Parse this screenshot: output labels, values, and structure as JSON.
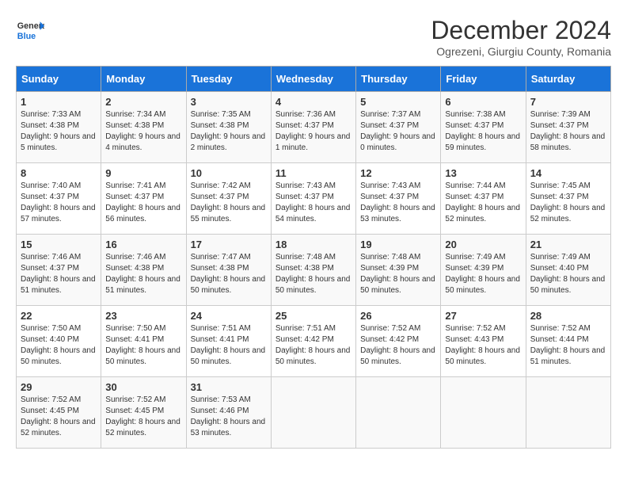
{
  "header": {
    "logo_line1": "General",
    "logo_line2": "Blue",
    "month_title": "December 2024",
    "subtitle": "Ogrezeni, Giurgiu County, Romania"
  },
  "columns": [
    "Sunday",
    "Monday",
    "Tuesday",
    "Wednesday",
    "Thursday",
    "Friday",
    "Saturday"
  ],
  "weeks": [
    [
      {
        "day": "1",
        "info": "Sunrise: 7:33 AM\nSunset: 4:38 PM\nDaylight: 9 hours and 5 minutes."
      },
      {
        "day": "2",
        "info": "Sunrise: 7:34 AM\nSunset: 4:38 PM\nDaylight: 9 hours and 4 minutes."
      },
      {
        "day": "3",
        "info": "Sunrise: 7:35 AM\nSunset: 4:38 PM\nDaylight: 9 hours and 2 minutes."
      },
      {
        "day": "4",
        "info": "Sunrise: 7:36 AM\nSunset: 4:37 PM\nDaylight: 9 hours and 1 minute."
      },
      {
        "day": "5",
        "info": "Sunrise: 7:37 AM\nSunset: 4:37 PM\nDaylight: 9 hours and 0 minutes."
      },
      {
        "day": "6",
        "info": "Sunrise: 7:38 AM\nSunset: 4:37 PM\nDaylight: 8 hours and 59 minutes."
      },
      {
        "day": "7",
        "info": "Sunrise: 7:39 AM\nSunset: 4:37 PM\nDaylight: 8 hours and 58 minutes."
      }
    ],
    [
      {
        "day": "8",
        "info": "Sunrise: 7:40 AM\nSunset: 4:37 PM\nDaylight: 8 hours and 57 minutes."
      },
      {
        "day": "9",
        "info": "Sunrise: 7:41 AM\nSunset: 4:37 PM\nDaylight: 8 hours and 56 minutes."
      },
      {
        "day": "10",
        "info": "Sunrise: 7:42 AM\nSunset: 4:37 PM\nDaylight: 8 hours and 55 minutes."
      },
      {
        "day": "11",
        "info": "Sunrise: 7:43 AM\nSunset: 4:37 PM\nDaylight: 8 hours and 54 minutes."
      },
      {
        "day": "12",
        "info": "Sunrise: 7:43 AM\nSunset: 4:37 PM\nDaylight: 8 hours and 53 minutes."
      },
      {
        "day": "13",
        "info": "Sunrise: 7:44 AM\nSunset: 4:37 PM\nDaylight: 8 hours and 52 minutes."
      },
      {
        "day": "14",
        "info": "Sunrise: 7:45 AM\nSunset: 4:37 PM\nDaylight: 8 hours and 52 minutes."
      }
    ],
    [
      {
        "day": "15",
        "info": "Sunrise: 7:46 AM\nSunset: 4:37 PM\nDaylight: 8 hours and 51 minutes."
      },
      {
        "day": "16",
        "info": "Sunrise: 7:46 AM\nSunset: 4:38 PM\nDaylight: 8 hours and 51 minutes."
      },
      {
        "day": "17",
        "info": "Sunrise: 7:47 AM\nSunset: 4:38 PM\nDaylight: 8 hours and 50 minutes."
      },
      {
        "day": "18",
        "info": "Sunrise: 7:48 AM\nSunset: 4:38 PM\nDaylight: 8 hours and 50 minutes."
      },
      {
        "day": "19",
        "info": "Sunrise: 7:48 AM\nSunset: 4:39 PM\nDaylight: 8 hours and 50 minutes."
      },
      {
        "day": "20",
        "info": "Sunrise: 7:49 AM\nSunset: 4:39 PM\nDaylight: 8 hours and 50 minutes."
      },
      {
        "day": "21",
        "info": "Sunrise: 7:49 AM\nSunset: 4:40 PM\nDaylight: 8 hours and 50 minutes."
      }
    ],
    [
      {
        "day": "22",
        "info": "Sunrise: 7:50 AM\nSunset: 4:40 PM\nDaylight: 8 hours and 50 minutes."
      },
      {
        "day": "23",
        "info": "Sunrise: 7:50 AM\nSunset: 4:41 PM\nDaylight: 8 hours and 50 minutes."
      },
      {
        "day": "24",
        "info": "Sunrise: 7:51 AM\nSunset: 4:41 PM\nDaylight: 8 hours and 50 minutes."
      },
      {
        "day": "25",
        "info": "Sunrise: 7:51 AM\nSunset: 4:42 PM\nDaylight: 8 hours and 50 minutes."
      },
      {
        "day": "26",
        "info": "Sunrise: 7:52 AM\nSunset: 4:42 PM\nDaylight: 8 hours and 50 minutes."
      },
      {
        "day": "27",
        "info": "Sunrise: 7:52 AM\nSunset: 4:43 PM\nDaylight: 8 hours and 50 minutes."
      },
      {
        "day": "28",
        "info": "Sunrise: 7:52 AM\nSunset: 4:44 PM\nDaylight: 8 hours and 51 minutes."
      }
    ],
    [
      {
        "day": "29",
        "info": "Sunrise: 7:52 AM\nSunset: 4:45 PM\nDaylight: 8 hours and 52 minutes."
      },
      {
        "day": "30",
        "info": "Sunrise: 7:52 AM\nSunset: 4:45 PM\nDaylight: 8 hours and 52 minutes."
      },
      {
        "day": "31",
        "info": "Sunrise: 7:53 AM\nSunset: 4:46 PM\nDaylight: 8 hours and 53 minutes."
      },
      {
        "day": "",
        "info": ""
      },
      {
        "day": "",
        "info": ""
      },
      {
        "day": "",
        "info": ""
      },
      {
        "day": "",
        "info": ""
      }
    ]
  ]
}
